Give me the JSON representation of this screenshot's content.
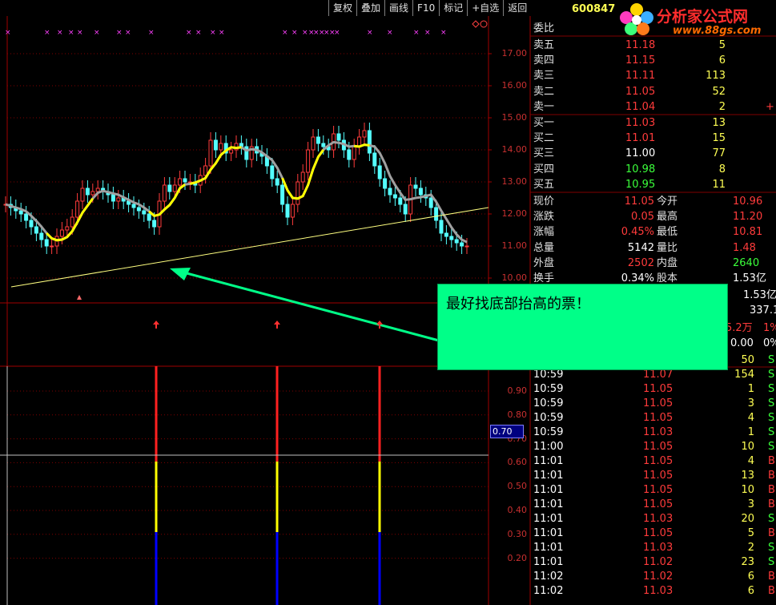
{
  "toolbar": {
    "items": [
      "复权",
      "叠加",
      "画线",
      "F10",
      "标记",
      "+自选",
      "返回"
    ]
  },
  "stock": {
    "code": "600847"
  },
  "logo": {
    "title": "分析家公式网",
    "url": "www.88gs.com"
  },
  "price_axis": {
    "ticks": [
      "17.00",
      "16.00",
      "15.00",
      "14.00",
      "13.00",
      "12.00",
      "11.00",
      "10.00"
    ]
  },
  "indicator_axis": {
    "ticks": [
      "0.90",
      "0.80",
      "0.70",
      "0.60",
      "0.50",
      "0.40",
      "0.30",
      "0.20"
    ],
    "current_value": "0.70"
  },
  "callout": {
    "text": "最好找底部抬高的票！"
  },
  "order_book": {
    "header": "委比",
    "asks": [
      {
        "label": "卖五",
        "price": "11.18",
        "vol": "5"
      },
      {
        "label": "卖四",
        "price": "11.15",
        "vol": "6"
      },
      {
        "label": "卖三",
        "price": "11.11",
        "vol": "113"
      },
      {
        "label": "卖二",
        "price": "11.05",
        "vol": "52"
      },
      {
        "label": "卖一",
        "price": "11.04",
        "vol": "2"
      }
    ],
    "bids": [
      {
        "label": "买一",
        "price": "11.03",
        "vol": "13"
      },
      {
        "label": "买二",
        "price": "11.01",
        "vol": "15"
      },
      {
        "label": "买三",
        "price": "11.00",
        "vol": "77"
      },
      {
        "label": "买四",
        "price": "10.98",
        "vol": "8"
      },
      {
        "label": "买五",
        "price": "10.95",
        "vol": "11"
      }
    ]
  },
  "quote": {
    "rows": [
      {
        "l1": "现价",
        "v1": "11.05",
        "l2": "今开",
        "v2": "10.96"
      },
      {
        "l1": "涨跌",
        "v1": "0.05",
        "l2": "最高",
        "v2": "11.20"
      },
      {
        "l1": "涨幅",
        "v1": "0.45%",
        "l2": "最低",
        "v2": "10.81"
      },
      {
        "l1": "总量",
        "v1": "5142",
        "l2": "量比",
        "v2": "1.48"
      },
      {
        "l1": "外盘",
        "v1": "2502",
        "l2": "内盘",
        "v2": "2640"
      },
      {
        "l1": "换手",
        "v1": "0.34%",
        "l2": "股本",
        "v2": "1.53亿"
      }
    ],
    "extra1": "1.53亿",
    "extra2": "337.1",
    "extra3": "5.2万",
    "extra4": "1%",
    "extra5": "0.00",
    "extra6": "0%"
  },
  "trades": [
    {
      "time": "",
      "price": "",
      "vol": "50",
      "side": "S"
    },
    {
      "time": "10:59",
      "price": "11.07",
      "vol": "154",
      "side": "S"
    },
    {
      "time": "10:59",
      "price": "11.05",
      "vol": "1",
      "side": "S"
    },
    {
      "time": "10:59",
      "price": "11.05",
      "vol": "3",
      "side": "S"
    },
    {
      "time": "10:59",
      "price": "11.05",
      "vol": "4",
      "side": "S"
    },
    {
      "time": "10:59",
      "price": "11.03",
      "vol": "1",
      "side": "S"
    },
    {
      "time": "11:00",
      "price": "11.05",
      "vol": "10",
      "side": "S"
    },
    {
      "time": "11:01",
      "price": "11.05",
      "vol": "4",
      "side": "B"
    },
    {
      "time": "11:01",
      "price": "11.05",
      "vol": "13",
      "side": "B"
    },
    {
      "time": "11:01",
      "price": "11.05",
      "vol": "10",
      "side": "B"
    },
    {
      "time": "11:01",
      "price": "11.05",
      "vol": "3",
      "side": "B"
    },
    {
      "time": "11:01",
      "price": "11.03",
      "vol": "20",
      "side": "S"
    },
    {
      "time": "11:01",
      "price": "11.05",
      "vol": "5",
      "side": "B"
    },
    {
      "time": "11:01",
      "price": "11.03",
      "vol": "2",
      "side": "S"
    },
    {
      "time": "11:01",
      "price": "11.02",
      "vol": "23",
      "side": "S"
    },
    {
      "time": "11:02",
      "price": "11.02",
      "vol": "6",
      "side": "B"
    },
    {
      "time": "11:02",
      "price": "11.03",
      "vol": "6",
      "side": "B"
    }
  ],
  "colors": {
    "up": "#ff3b3b",
    "down": "#54ffff",
    "signal_top": "#ff2020",
    "signal_mid": "#ffff00",
    "signal_bot": "#0000ff",
    "callout_bg": "#00ff88"
  }
}
